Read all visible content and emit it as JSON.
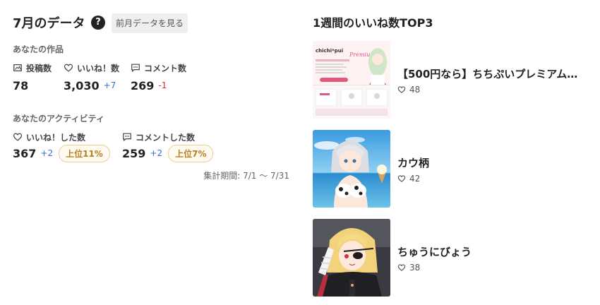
{
  "stats": {
    "month_title": "7月のデータ",
    "help_icon": "?",
    "prev_button": "前月データを見る",
    "works": {
      "section_label": "あなたの作品",
      "posts": {
        "label": "投稿数",
        "value": "78"
      },
      "likes": {
        "label": "いいね！数",
        "value": "3,030",
        "delta": "+7"
      },
      "comments": {
        "label": "コメント数",
        "value": "269",
        "delta": "-1"
      }
    },
    "activity": {
      "section_label": "あなたのアクティビティ",
      "likes_given": {
        "label": "いいね！した数",
        "value": "367",
        "delta": "+2",
        "rank": "上位11%"
      },
      "comments_given": {
        "label": "コメントした数",
        "value": "259",
        "delta": "+2",
        "rank": "上位7%"
      }
    },
    "period": "集計期間: 7/1 〜 7/31"
  },
  "top3": {
    "title": "1週間のいいね数TOP3",
    "items": [
      {
        "title": "【500円なら】ちちぷいプレミアム…",
        "likes": "48",
        "thumb_text": "chichi*pui",
        "thumb_text2": "Premium"
      },
      {
        "title": "カウ柄",
        "likes": "42"
      },
      {
        "title": "ちゅうにびょう",
        "likes": "38"
      }
    ]
  },
  "colors": {
    "delta_up": "#3a6fd8",
    "delta_down": "#e0283f",
    "badge_gold": "#b8811f",
    "badge_border": "#e9cf9a"
  }
}
